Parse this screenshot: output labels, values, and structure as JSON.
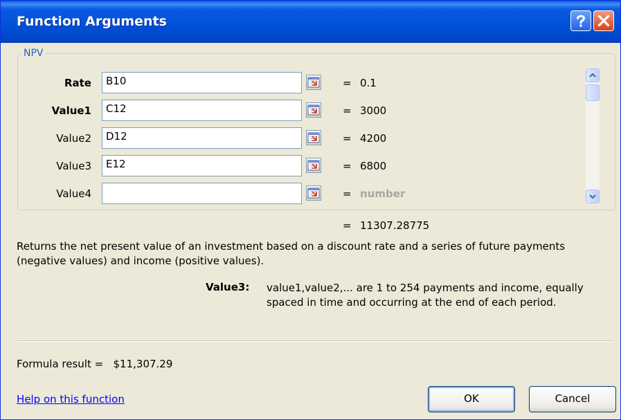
{
  "window": {
    "title": "Function Arguments"
  },
  "group": {
    "label": "NPV"
  },
  "args": [
    {
      "label": "Rate",
      "value": "B10",
      "eq": "=",
      "result": "0.1"
    },
    {
      "label": "Value1",
      "value": "C12",
      "eq": "=",
      "result": "3000"
    },
    {
      "label": "Value2",
      "value": "D12",
      "eq": "=",
      "result": "4200"
    },
    {
      "label": "Value3",
      "value": "E12",
      "eq": "=",
      "result": "6800"
    },
    {
      "label": "Value4",
      "value": "",
      "eq": "=",
      "result": "number"
    }
  ],
  "total": {
    "eq": "=",
    "value": "11307.28775"
  },
  "description": "Returns the net present value of an investment based on a discount rate and a series of future payments (negative values) and income (positive values).",
  "arg_help": {
    "label": "Value3:",
    "text": "value1,value2,... are 1 to 254 payments and income, equally spaced in time and occurring at the end of each period."
  },
  "formula_result": "Formula result =   $11,307.29",
  "help_link": "Help on this function",
  "buttons": {
    "ok": "OK",
    "cancel": "Cancel"
  },
  "icons": {
    "help": "question-mark-icon",
    "close": "close-icon",
    "ref": "collapse-dialog-icon",
    "scroll_up": "chevron-up-icon",
    "scroll_down": "chevron-down-icon"
  },
  "colors": {
    "titlebar": "#0050d8",
    "close": "#d8411b",
    "link": "#0000ff",
    "group_label": "#2860c8"
  }
}
